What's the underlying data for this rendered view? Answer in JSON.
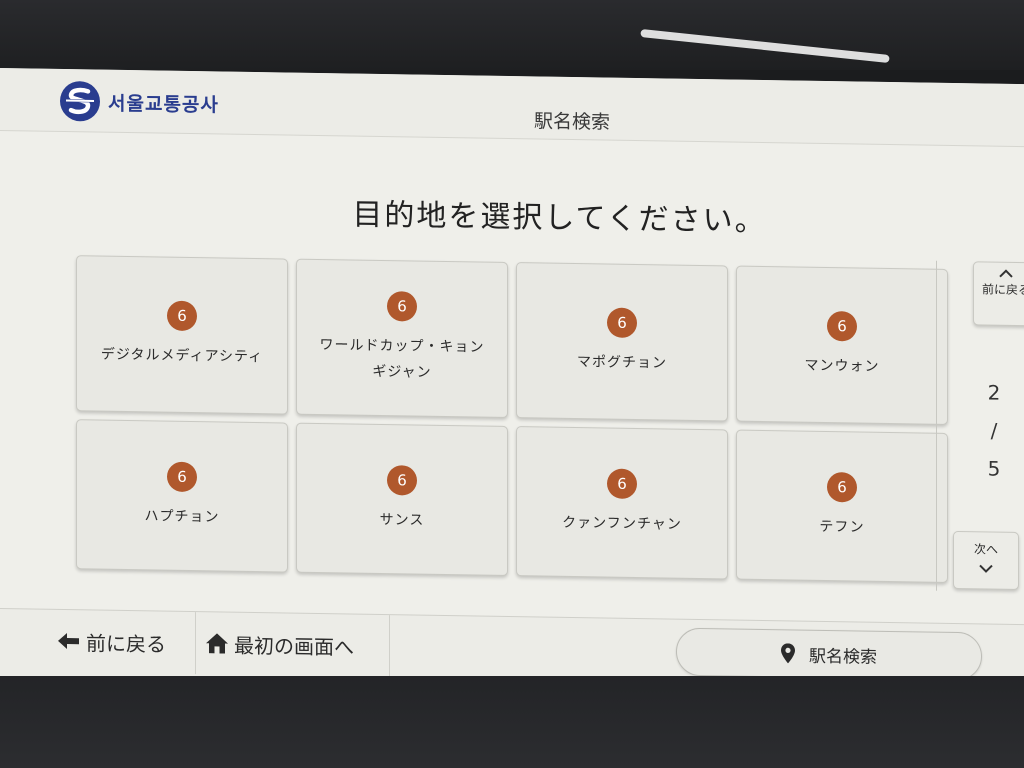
{
  "header": {
    "logo_text": "서울교통공사",
    "title": "駅名検索"
  },
  "instruction": "目的地を選択してください。",
  "stations": [
    {
      "line": "6",
      "name": "デジタルメディアシティ"
    },
    {
      "line": "6",
      "name": "ワールドカップ・キョンギジャン"
    },
    {
      "line": "6",
      "name": "マポグチョン"
    },
    {
      "line": "6",
      "name": "マンウォン"
    },
    {
      "line": "6",
      "name": "ハプチョン"
    },
    {
      "line": "6",
      "name": "サンス"
    },
    {
      "line": "6",
      "name": "クァンフンチャン"
    },
    {
      "line": "6",
      "name": "テフン"
    }
  ],
  "colors": {
    "line_6": "#b0582c",
    "brand": "#2a3d8f"
  },
  "pager": {
    "prev_label": "前に戻る",
    "next_label": "次へ",
    "current_page": "2",
    "separator": "/",
    "total_pages": "5"
  },
  "footer": {
    "back_label": "前に戻る",
    "home_label": "最初の画面へ",
    "search_label": "駅名検索"
  },
  "icons": {
    "back": "arrow-left-icon",
    "home": "home-icon",
    "search": "map-pin-icon",
    "prev": "chevron-up-icon",
    "next": "chevron-down-icon"
  }
}
